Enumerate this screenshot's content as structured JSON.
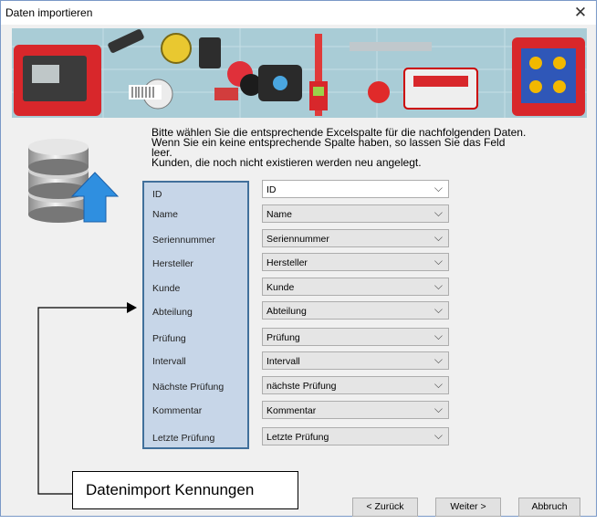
{
  "window": {
    "title": "Daten importieren",
    "close_glyph": "✕"
  },
  "intro": {
    "line1": "Bitte wählen Sie die entsprechende Excelspalte für die nachfolgenden Daten.",
    "line2": "Wenn Sie ein keine entsprechende Spalte haben, so lassen Sie das Feld",
    "line3": "leer.",
    "line4": "Kunden, die noch nicht existieren werden neu angelegt."
  },
  "fields": [
    {
      "label": "ID",
      "value": "ID"
    },
    {
      "label": "Name",
      "value": "Name"
    },
    {
      "label": "Seriennummer",
      "value": "Seriennummer"
    },
    {
      "label": "Hersteller",
      "value": "Hersteller"
    },
    {
      "label": "Kunde",
      "value": "Kunde"
    },
    {
      "label": "Abteilung",
      "value": "Abteilung"
    },
    {
      "label": "Prüfung",
      "value": "Prüfung"
    },
    {
      "label": "Intervall",
      "value": "Intervall"
    },
    {
      "label": "Nächste Prüfung",
      "value": "nächste Prüfung"
    },
    {
      "label": "Kommentar",
      "value": "Kommentar"
    },
    {
      "label": "Letzte Prüfung",
      "value": "Letzte Prüfung"
    }
  ],
  "buttons": {
    "back": "< Zurück",
    "next": "Weiter >",
    "cancel": "Abbruch"
  },
  "callout": {
    "text": "Datenimport Kennungen"
  },
  "icons": {
    "database": "database-import-icon",
    "chevron": "chevron-down-icon"
  },
  "colors": {
    "label_panel": "#c7d6e8",
    "label_border": "#41709b",
    "banner": "#9ec3cf",
    "arrow": "#2f8fe0"
  }
}
